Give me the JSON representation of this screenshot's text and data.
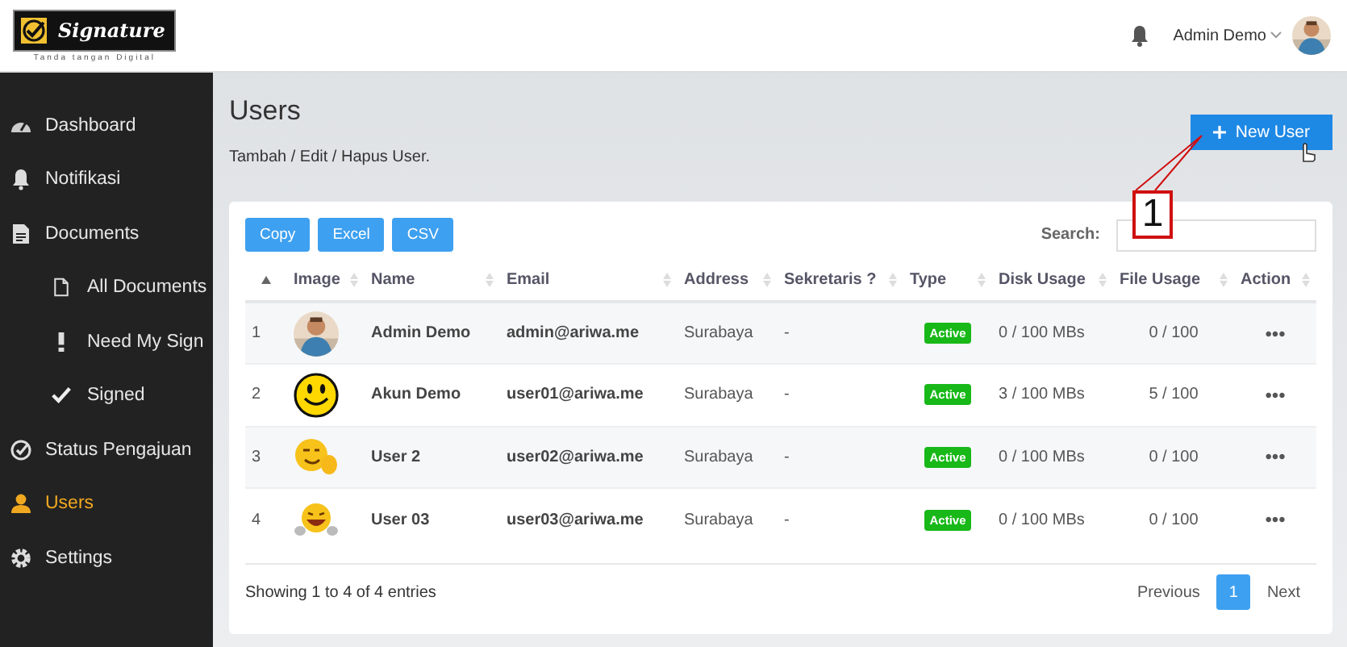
{
  "header": {
    "logo": {
      "name": "Signature",
      "tagline": "Tanda tangan Digital"
    },
    "user_menu": {
      "name": "Admin Demo"
    }
  },
  "sidebar": {
    "items": [
      {
        "label": "Dashboard",
        "selected": false
      },
      {
        "label": "Notifikasi",
        "selected": false
      },
      {
        "label": "Documents",
        "selected": false,
        "children": [
          {
            "label": "All Documents",
            "selected": false
          },
          {
            "label": "Need My Sign",
            "selected": false
          },
          {
            "label": "Signed",
            "selected": false
          }
        ]
      },
      {
        "label": "Status Pengajuan",
        "selected": false
      },
      {
        "label": "Users",
        "selected": true
      },
      {
        "label": "Settings",
        "selected": false
      }
    ]
  },
  "page": {
    "title": "Users",
    "subtitle": "Tambah / Edit / Hapus User.",
    "new_button": "New User",
    "callout": "1"
  },
  "table": {
    "export_buttons": [
      "Copy",
      "Excel",
      "CSV"
    ],
    "search_label": "Search:",
    "columns": [
      {
        "sorted": true
      },
      {
        "label": "Image",
        "sorted": false
      },
      {
        "label": "Name",
        "sorted": false
      },
      {
        "label": "Email",
        "sorted": false
      },
      {
        "label": "Address",
        "sorted": false
      },
      {
        "label": "Sekretaris ?",
        "sorted": false
      },
      {
        "label": "Type",
        "sorted": false
      },
      {
        "label": "Disk Usage",
        "sorted": false
      },
      {
        "label": "File Usage",
        "sorted": false
      },
      {
        "label": "Action",
        "sorted": false
      }
    ],
    "rows": [
      {
        "no": "1",
        "name": "Admin Demo",
        "email": "admin@ariwa.me",
        "address": "Surabaya",
        "sekretaris": "-",
        "type": "Active",
        "disk": "0 / 100 MBs",
        "files": "0 / 100",
        "action": "•••"
      },
      {
        "no": "2",
        "image": {
          "kind": "smiley"
        },
        "name": "Akun Demo",
        "email": "user01@ariwa.me",
        "address": "Surabaya",
        "sekretaris": "-",
        "type": "Active",
        "disk": "3 / 100 MBs",
        "files": "5 / 100",
        "action": "•••"
      },
      {
        "no": "3",
        "image": {
          "kind": "wink"
        },
        "name": "User 2",
        "email": "user02@ariwa.me",
        "address": "Surabaya",
        "sekretaris": "-",
        "type": "Active",
        "disk": "0 / 100 MBs",
        "files": "0 / 100",
        "action": "•••"
      },
      {
        "no": "4",
        "image": {
          "kind": "laugh"
        },
        "name": "User 03",
        "email": "user03@ariwa.me",
        "address": "Surabaya",
        "sekretaris": "-",
        "type": "Active",
        "disk": "0 / 100 MBs",
        "files": "0 / 100",
        "action": "•••"
      }
    ],
    "info": "Showing 1 to 4 of 4 entries",
    "pagination": {
      "previous": "Previous",
      "pages": [
        {
          "label": "1",
          "selected": true
        }
      ],
      "next": "Next"
    }
  }
}
